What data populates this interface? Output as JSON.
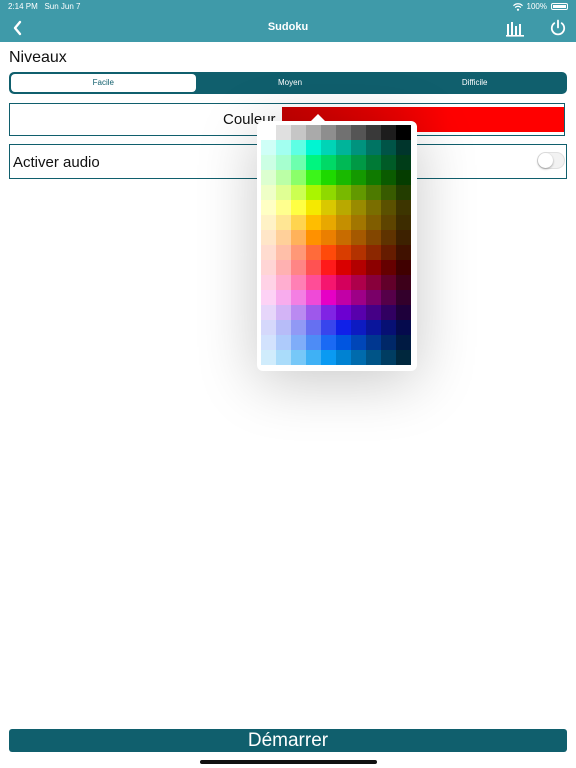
{
  "status_bar": {
    "time": "2:14 PM",
    "date": "Sun Jun 7",
    "battery": "100%"
  },
  "nav": {
    "title": "Sudoku"
  },
  "levels": {
    "title": "Niveaux",
    "options": [
      "Facile",
      "Moyen",
      "Difficile"
    ],
    "selected": "Facile"
  },
  "color_setting": {
    "label": "Couleur",
    "value": "#ff0000"
  },
  "audio_setting": {
    "label": "Activer audio",
    "enabled": false
  },
  "palette": {
    "rows": [
      [
        "#ffffff",
        "#e0e0e0",
        "#c6c6c6",
        "#aaaaaa",
        "#8e8e8e",
        "#717171",
        "#555555",
        "#393939",
        "#1d1d1d",
        "#000000"
      ],
      [
        "#cffff7",
        "#a2fff0",
        "#5effe4",
        "#00f5d2",
        "#00d4b6",
        "#00b49a",
        "#00937e",
        "#007463",
        "#005447",
        "#00352c"
      ],
      [
        "#ccffe4",
        "#a6ffcf",
        "#6dffae",
        "#00f57f",
        "#00d966",
        "#00b955",
        "#009945",
        "#007a36",
        "#005b27",
        "#003d18"
      ],
      [
        "#dcffd0",
        "#bbffa6",
        "#8bff6a",
        "#3cf51a",
        "#1ed900",
        "#19b900",
        "#149900",
        "#0f7a00",
        "#0a5b00",
        "#053d00"
      ],
      [
        "#efffc7",
        "#e0ff94",
        "#ccff52",
        "#aaf500",
        "#8fd900",
        "#78b900",
        "#629900",
        "#4d7a00",
        "#385b00",
        "#233d00"
      ],
      [
        "#ffffc4",
        "#ffff8e",
        "#ffff43",
        "#f5e900",
        "#d9c800",
        "#b9a900",
        "#998b00",
        "#7a6e00",
        "#5b5100",
        "#3d3500"
      ],
      [
        "#fff2c6",
        "#ffe694",
        "#ffd44f",
        "#ffbd00",
        "#e8a800",
        "#c58f00",
        "#a27600",
        "#805d00",
        "#5e4400",
        "#3d2c00"
      ],
      [
        "#ffe6c8",
        "#ffd09a",
        "#ffb25a",
        "#ff9100",
        "#eb7f00",
        "#c86c00",
        "#a55900",
        "#824600",
        "#5f3300",
        "#3d2100"
      ],
      [
        "#ffdcd0",
        "#ffbfa9",
        "#ff9877",
        "#ff6b3a",
        "#ff4a0a",
        "#d93d00",
        "#b33200",
        "#8c2700",
        "#661c00",
        "#401100"
      ],
      [
        "#ffd5d5",
        "#ffb1b1",
        "#ff8585",
        "#ff5252",
        "#ff1a1a",
        "#d90000",
        "#b30000",
        "#8c0000",
        "#660000",
        "#400000"
      ],
      [
        "#ffd2e6",
        "#ffaed0",
        "#ff80b5",
        "#ff4d97",
        "#f5166f",
        "#d4005c",
        "#ae004b",
        "#88003b",
        "#62002a",
        "#3d001a"
      ],
      [
        "#fdd2f5",
        "#f8aced",
        "#f47fe3",
        "#ef4ad7",
        "#e600c5",
        "#c200a6",
        "#9e0087",
        "#7a0068",
        "#560049",
        "#33002b"
      ],
      [
        "#e6d6fa",
        "#d3b4f6",
        "#ba8af1",
        "#9e58eb",
        "#8024e4",
        "#6c00d1",
        "#5800ac",
        "#450086",
        "#310061",
        "#1e003b"
      ],
      [
        "#d5d8fb",
        "#b7bcf8",
        "#9199f5",
        "#6670f1",
        "#3845ed",
        "#1020e8",
        "#0d1bc2",
        "#0a159b",
        "#071074",
        "#050a4d"
      ],
      [
        "#d2e2fd",
        "#aecbfb",
        "#7fadf9",
        "#4d8cf6",
        "#1a6af4",
        "#0055e0",
        "#0046b8",
        "#003790",
        "#002868",
        "#001a42"
      ],
      [
        "#d0ecfc",
        "#aadcfa",
        "#77c8f8",
        "#3fb1f5",
        "#0a9af2",
        "#0082d2",
        "#006bad",
        "#005487",
        "#003d62",
        "#00273d"
      ]
    ]
  }
}
